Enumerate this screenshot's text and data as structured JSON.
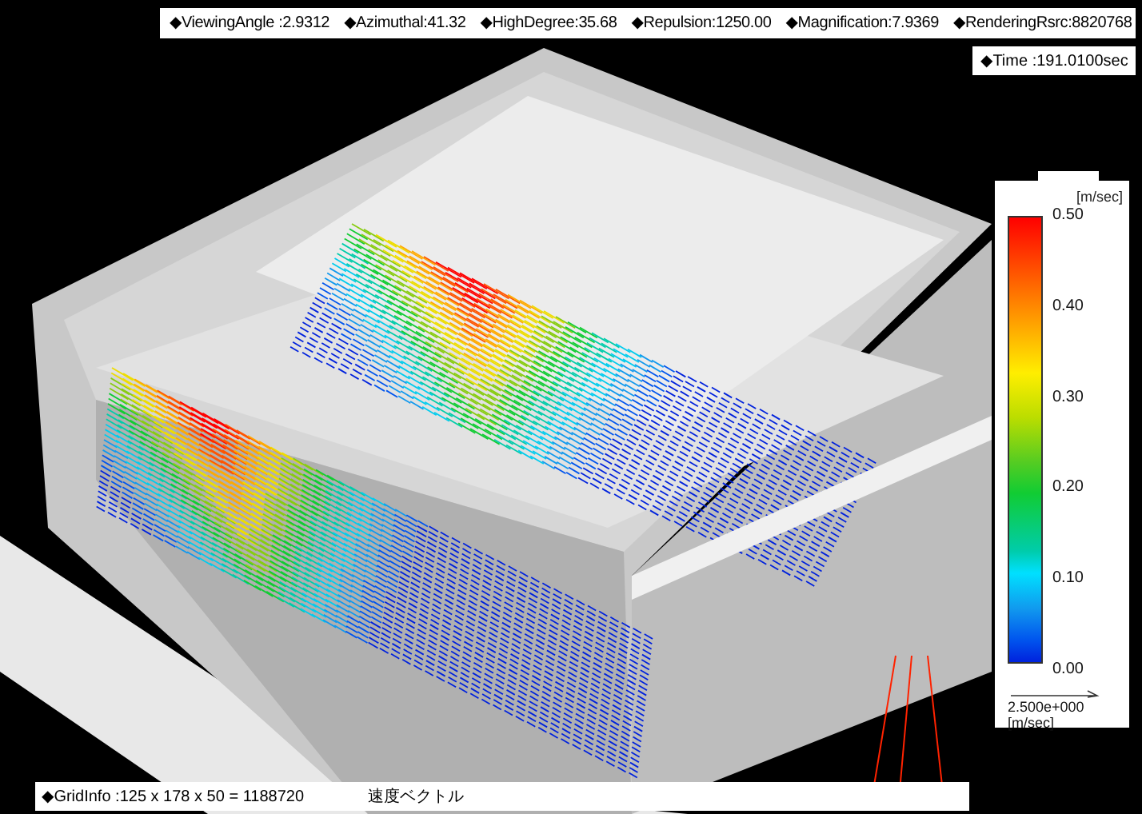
{
  "info_bar": {
    "items": [
      "◆ViewingAngle :2.9312",
      "◆Azimuthal:41.32",
      "◆HighDegree:35.68",
      "◆Repulsion:1250.00",
      "◆Magnification:7.9369",
      "◆RenderingRsrc:8820768"
    ]
  },
  "time": "◆Time :191.0100sec",
  "legend": {
    "unit": "[m/sec]",
    "ticks": [
      "0.50",
      "0.40",
      "0.30",
      "0.20",
      "0.10",
      "0.00"
    ],
    "scale_value": "2.500e+000",
    "scale_unit": "[m/sec]"
  },
  "grid_info": "◆GridInfo :125 x 178 x 50 = 1188720",
  "view_label": "速度ベクトル"
}
